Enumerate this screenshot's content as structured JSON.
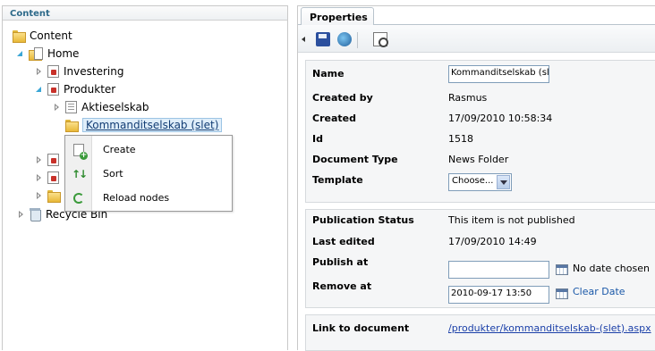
{
  "left_panel": {
    "title": "Content"
  },
  "tree": {
    "content": "Content",
    "home": "Home",
    "investering": "Investering",
    "produkter": "Produkter",
    "aktieselskab": "Aktieselskab",
    "kommanditselskab": "Kommanditselskab (slet)",
    "recycle_bin": "Recycle Bin"
  },
  "context_menu": {
    "create": "Create",
    "sort": "Sort",
    "reload": "Reload nodes"
  },
  "right_panel": {
    "tab": "Properties"
  },
  "toolbar": {
    "collapse_icon": "caret-left-icon",
    "save_icon": "save-icon",
    "save_publish_icon": "globe-icon",
    "preview_icon": "preview-icon"
  },
  "properties": {
    "name_label": "Name",
    "name_value": "Kommanditselskab (slet)",
    "created_by_label": "Created by",
    "created_by_value": "Rasmus",
    "created_label": "Created",
    "created_value": "17/09/2010 10:58:34",
    "id_label": "Id",
    "id_value": "1518",
    "doctype_label": "Document Type",
    "doctype_value": "News Folder",
    "template_label": "Template",
    "template_value": "Choose..."
  },
  "publishing": {
    "status_label": "Publication Status",
    "status_value": "This item is not published",
    "last_edited_label": "Last edited",
    "last_edited_value": "17/09/2010 14:49",
    "publish_at_label": "Publish at",
    "publish_at_value": "",
    "publish_at_note": "No date chosen",
    "remove_at_label": "Remove at",
    "remove_at_value": "2010-09-17 13:50",
    "clear_date": "Clear Date"
  },
  "link": {
    "label": "Link to document",
    "value": "/produkter/kommanditselskab-(slet).aspx"
  }
}
